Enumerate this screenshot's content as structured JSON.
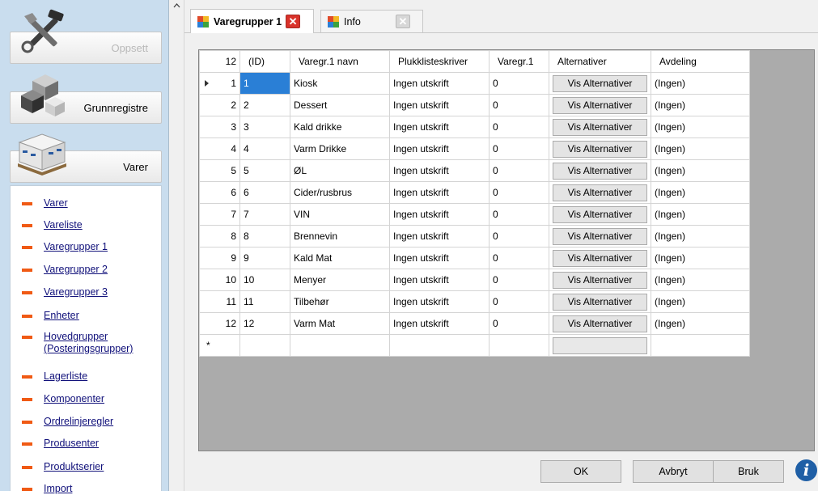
{
  "sidebar": {
    "buttons": [
      {
        "label": "Oppsett",
        "icon": "tools-icon",
        "disabled": true
      },
      {
        "label": "Grunnregistre",
        "icon": "cubes-icon"
      },
      {
        "label": "Varer",
        "icon": "pallet-boxes-icon"
      }
    ],
    "items": [
      {
        "label": "Varer"
      },
      {
        "label": "Vareliste"
      },
      {
        "label": "Varegrupper 1"
      },
      {
        "label": "Varegrupper 2"
      },
      {
        "label": "Varegrupper 3"
      },
      {
        "label": "Enheter"
      },
      {
        "label": "Hovedgrupper (Posteringsgrupper)"
      },
      {
        "label": "Lagerliste"
      },
      {
        "label": "Komponenter"
      },
      {
        "label": "Ordrelinjeregler"
      },
      {
        "label": "Produsenter"
      },
      {
        "label": "Produktserier"
      },
      {
        "label": "Import"
      }
    ]
  },
  "tabs": [
    {
      "label": "Varegrupper 1",
      "close": "✕",
      "active": true
    },
    {
      "label": "Info",
      "close": "✕",
      "active": false
    }
  ],
  "grid": {
    "row_count": "12",
    "columns": [
      "(ID)",
      "Varegr.1 navn",
      "Plukklisteskriver",
      "Varegr.1",
      "Alternativer",
      "Avdeling"
    ],
    "rows": [
      {
        "n": "1",
        "id": "1",
        "name": "Kiosk",
        "printer": "Ingen utskrift",
        "vg": "0",
        "alt": "Vis Alternativer",
        "dept": "(Ingen)"
      },
      {
        "n": "2",
        "id": "2",
        "name": "Dessert",
        "printer": "Ingen utskrift",
        "vg": "0",
        "alt": "Vis Alternativer",
        "dept": "(Ingen)"
      },
      {
        "n": "3",
        "id": "3",
        "name": "Kald drikke",
        "printer": "Ingen utskrift",
        "vg": "0",
        "alt": "Vis Alternativer",
        "dept": "(Ingen)"
      },
      {
        "n": "4",
        "id": "4",
        "name": "Varm Drikke",
        "printer": "Ingen utskrift",
        "vg": "0",
        "alt": "Vis Alternativer",
        "dept": "(Ingen)"
      },
      {
        "n": "5",
        "id": "5",
        "name": "ØL",
        "printer": "Ingen utskrift",
        "vg": "0",
        "alt": "Vis Alternativer",
        "dept": "(Ingen)"
      },
      {
        "n": "6",
        "id": "6",
        "name": "Cider/rusbrus",
        "printer": "Ingen utskrift",
        "vg": "0",
        "alt": "Vis Alternativer",
        "dept": "(Ingen)"
      },
      {
        "n": "7",
        "id": "7",
        "name": "VIN",
        "printer": "Ingen utskrift",
        "vg": "0",
        "alt": "Vis Alternativer",
        "dept": "(Ingen)"
      },
      {
        "n": "8",
        "id": "8",
        "name": "Brennevin",
        "printer": "Ingen utskrift",
        "vg": "0",
        "alt": "Vis Alternativer",
        "dept": "(Ingen)"
      },
      {
        "n": "9",
        "id": "9",
        "name": "Kald Mat",
        "printer": "Ingen utskrift",
        "vg": "0",
        "alt": "Vis Alternativer",
        "dept": "(Ingen)"
      },
      {
        "n": "10",
        "id": "10",
        "name": "Menyer",
        "printer": "Ingen utskrift",
        "vg": "0",
        "alt": "Vis Alternativer",
        "dept": "(Ingen)"
      },
      {
        "n": "11",
        "id": "11",
        "name": "Tilbehør",
        "printer": "Ingen utskrift",
        "vg": "0",
        "alt": "Vis Alternativer",
        "dept": "(Ingen)"
      },
      {
        "n": "12",
        "id": "12",
        "name": "Varm Mat",
        "printer": "Ingen utskrift",
        "vg": "0",
        "alt": "Vis Alternativer",
        "dept": "(Ingen)"
      }
    ],
    "new_row_marker": "*"
  },
  "footer": {
    "ok": "OK",
    "cancel": "Avbryt",
    "apply": "Bruk"
  },
  "colors": {
    "accent_bullet": "#f05a14",
    "selection": "#2a7fd6",
    "sidebar_bg": "#c9ddee",
    "close_red": "#d9322a"
  }
}
